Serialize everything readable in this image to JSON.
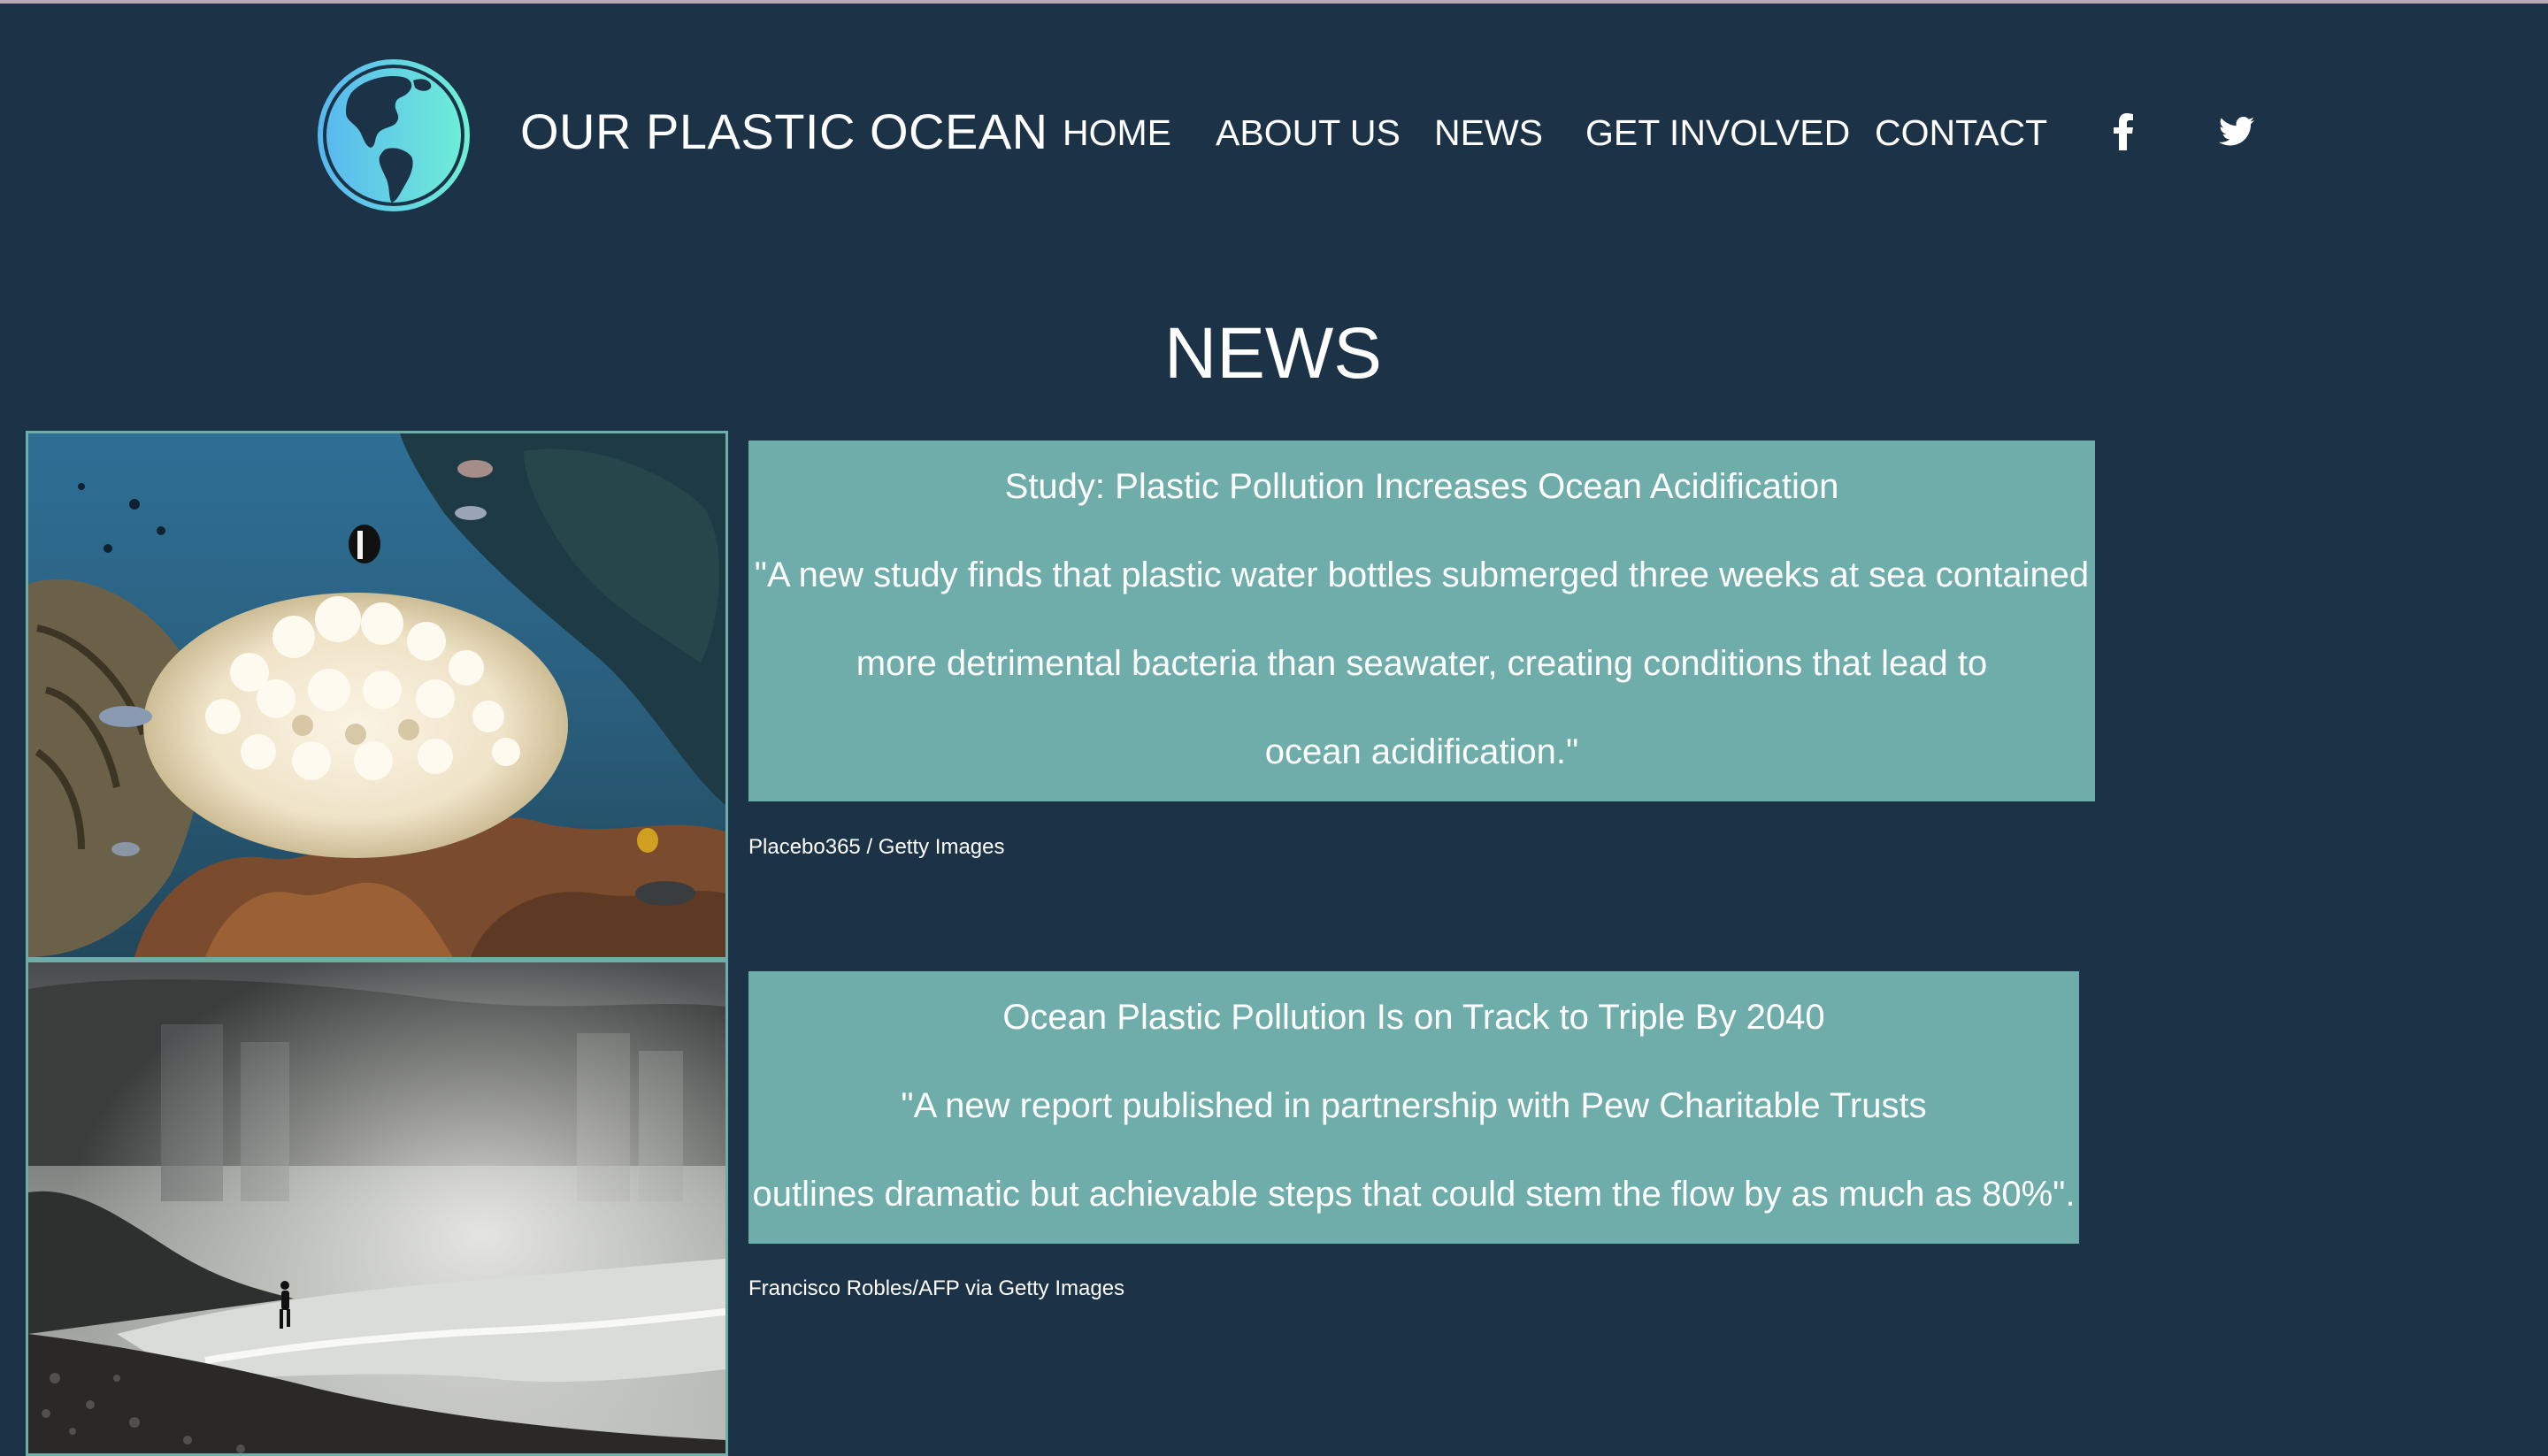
{
  "site": {
    "title": "OUR PLASTIC OCEAN",
    "logo_icon": "globe-icon"
  },
  "nav": {
    "items": [
      {
        "label": "HOME"
      },
      {
        "label": "ABOUT US"
      },
      {
        "label": "NEWS"
      },
      {
        "label": "GET INVOLVED"
      },
      {
        "label": "CONTACT"
      }
    ],
    "social": [
      {
        "icon": "facebook-icon"
      },
      {
        "icon": "twitter-icon"
      }
    ]
  },
  "section": {
    "title": "NEWS"
  },
  "articles": [
    {
      "image": "bleached-coral-reef-photo",
      "headline": "Study: Plastic Pollution Increases Ocean Acidification",
      "quote_lines": [
        "\"A new study finds that plastic water bottles submerged three weeks at sea contained",
        "more detrimental bacteria than seawater, creating conditions that lead to",
        "ocean acidification.\""
      ],
      "credit": "Placebo365 / Getty Images"
    },
    {
      "image": "misty-beach-walker-photo",
      "headline": "Ocean Plastic Pollution Is on Track to Triple By 2040",
      "quote_lines": [
        "\"A new report published in partnership with Pew Charitable Trusts",
        "outlines dramatic but achievable steps that could stem the flow by as much as 80%\"."
      ],
      "credit": "Francisco Robles/AFP via Getty Images"
    }
  ],
  "colors": {
    "background": "#1c3246",
    "card": "#6fadab",
    "text": "#ffffff",
    "globe_light": "#5fe0d0",
    "globe_dark": "#1c3246"
  }
}
